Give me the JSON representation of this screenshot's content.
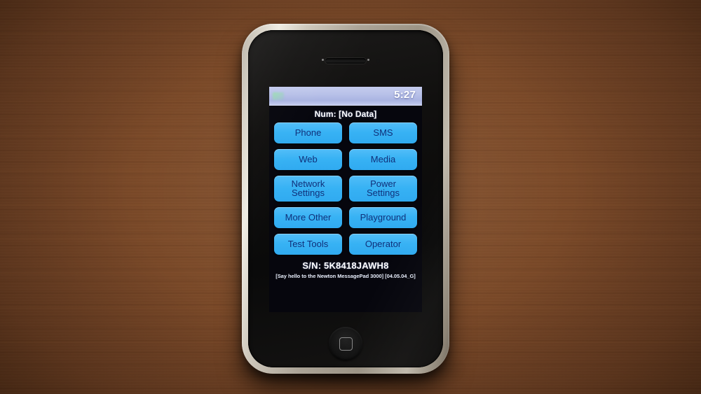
{
  "device": {
    "name": "iphone-2g",
    "earpiece_label": "earpiece-speaker",
    "home_button_label": "home-button",
    "bezel_color": "#cfc9bd",
    "body_color": "#0c0c0c"
  },
  "background": {
    "surface": "wooden-desk",
    "color": "#7d4b29"
  },
  "screen": {
    "status_bar": {
      "time": "5:27",
      "signal_icon": "signal-bars-icon",
      "background_color": "#b7c0e8",
      "time_color": "#ffffff"
    },
    "num_line": "Num:  [No Data]",
    "accent_color": "#37b2f4",
    "button_text_color": "#10307a",
    "buttons": [
      [
        {
          "label": "Phone",
          "name": "phone-button"
        },
        {
          "label": "SMS",
          "name": "sms-button"
        }
      ],
      [
        {
          "label": "Web",
          "name": "web-button"
        },
        {
          "label": "Media",
          "name": "media-button"
        }
      ],
      [
        {
          "label": "Network\nSettings",
          "name": "network-settings-button"
        },
        {
          "label": "Power\nSettings",
          "name": "power-settings-button"
        }
      ],
      [
        {
          "label": "More Other",
          "name": "more-other-button"
        },
        {
          "label": "Playground",
          "name": "playground-button"
        }
      ],
      [
        {
          "label": "Test Tools",
          "name": "test-tools-button"
        },
        {
          "label": "Operator",
          "name": "operator-button"
        }
      ]
    ],
    "serial_number": "S/N: 5K8418JAWH8",
    "build_note": "[Say hello to the Newton MessagePad 3000] [04.05.04_G]"
  }
}
